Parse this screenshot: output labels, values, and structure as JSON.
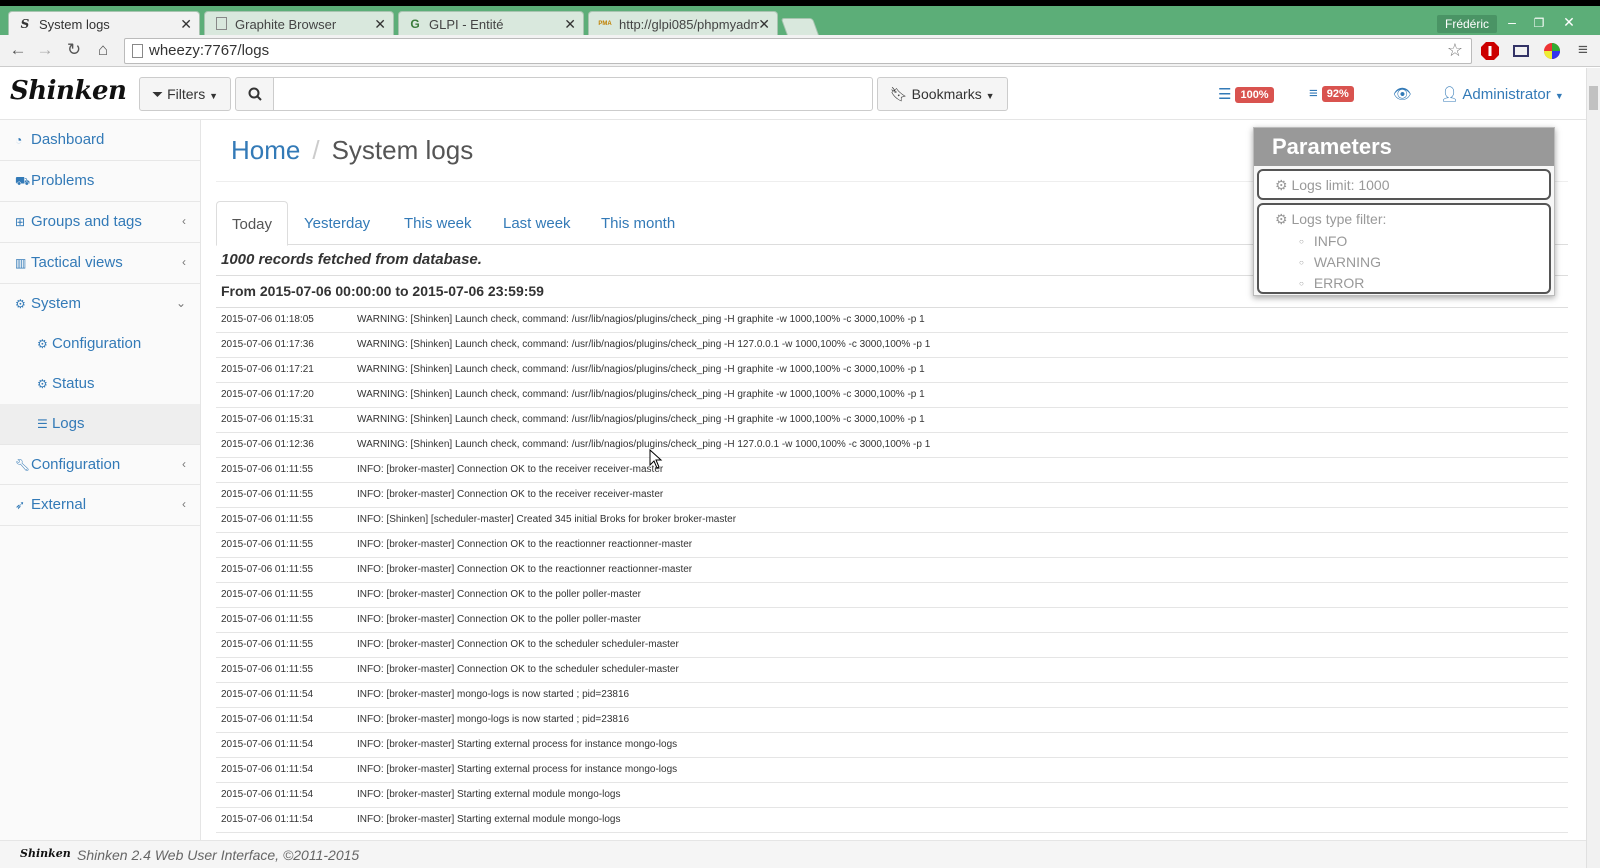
{
  "browser": {
    "tabs": [
      {
        "title": "System logs",
        "favicon": "S",
        "active": true
      },
      {
        "title": "Graphite Browser",
        "favicon": "page-icon",
        "active": false
      },
      {
        "title": "GLPI - Entité",
        "favicon": "G",
        "active": false
      },
      {
        "title": "http://glpi085/phpmyadm",
        "favicon": "PMA",
        "active": false
      }
    ],
    "window_user": "Frédéric",
    "url": "wheezy:7767/logs"
  },
  "header": {
    "logo": "Shinken",
    "filters_label": "Filters",
    "search_placeholder": "",
    "bookmarks_label": "Bookmarks",
    "indicator1_value": "100%",
    "indicator2_value": "92%",
    "user_label": "Administrator"
  },
  "sidebar": {
    "items": [
      {
        "label": "Dashboard",
        "icon": "dashboard-icon"
      },
      {
        "label": "Problems",
        "icon": "ambulance-icon"
      },
      {
        "label": "Groups and tags",
        "icon": "sitemap-icon"
      },
      {
        "label": "Tactical views",
        "icon": "bar-chart-icon"
      },
      {
        "label": "System",
        "icon": "gears-icon"
      },
      {
        "label": "Configuration",
        "icon": "gears-icon"
      },
      {
        "label": "Status",
        "icon": "gears-icon"
      },
      {
        "label": "Logs",
        "icon": "list-icon"
      },
      {
        "label": "Configuration",
        "icon": "wrench-icon"
      },
      {
        "label": "External",
        "icon": "rocket-icon"
      }
    ]
  },
  "breadcrumb": {
    "home": "Home",
    "current": "System logs"
  },
  "period_tabs": [
    "Today",
    "Yesterday",
    "This week",
    "Last week",
    "This month"
  ],
  "records_text": "1000 records fetched from database.",
  "range_text": "From 2015-07-06 00:00:00 to 2015-07-06 23:59:59",
  "logs": [
    {
      "ts": "2015-07-06 01:18:05",
      "msg": "WARNING: [Shinken] Launch check, command: /usr/lib/nagios/plugins/check_ping -H graphite -w 1000,100% -c 3000,100% -p 1"
    },
    {
      "ts": "2015-07-06 01:17:36",
      "msg": "WARNING: [Shinken] Launch check, command: /usr/lib/nagios/plugins/check_ping -H 127.0.0.1 -w 1000,100% -c 3000,100% -p 1"
    },
    {
      "ts": "2015-07-06 01:17:21",
      "msg": "WARNING: [Shinken] Launch check, command: /usr/lib/nagios/plugins/check_ping -H graphite -w 1000,100% -c 3000,100% -p 1"
    },
    {
      "ts": "2015-07-06 01:17:20",
      "msg": "WARNING: [Shinken] Launch check, command: /usr/lib/nagios/plugins/check_ping -H graphite -w 1000,100% -c 3000,100% -p 1"
    },
    {
      "ts": "2015-07-06 01:15:31",
      "msg": "WARNING: [Shinken] Launch check, command: /usr/lib/nagios/plugins/check_ping -H graphite -w 1000,100% -c 3000,100% -p 1"
    },
    {
      "ts": "2015-07-06 01:12:36",
      "msg": "WARNING: [Shinken] Launch check, command: /usr/lib/nagios/plugins/check_ping -H 127.0.0.1 -w 1000,100% -c 3000,100% -p 1"
    },
    {
      "ts": "2015-07-06 01:11:55",
      "msg": "INFO: [broker-master] Connection OK to the receiver receiver-master"
    },
    {
      "ts": "2015-07-06 01:11:55",
      "msg": "INFO: [broker-master] Connection OK to the receiver receiver-master"
    },
    {
      "ts": "2015-07-06 01:11:55",
      "msg": "INFO: [Shinken] [scheduler-master] Created 345 initial Broks for broker broker-master"
    },
    {
      "ts": "2015-07-06 01:11:55",
      "msg": "INFO: [broker-master] Connection OK to the reactionner reactionner-master"
    },
    {
      "ts": "2015-07-06 01:11:55",
      "msg": "INFO: [broker-master] Connection OK to the reactionner reactionner-master"
    },
    {
      "ts": "2015-07-06 01:11:55",
      "msg": "INFO: [broker-master] Connection OK to the poller poller-master"
    },
    {
      "ts": "2015-07-06 01:11:55",
      "msg": "INFO: [broker-master] Connection OK to the poller poller-master"
    },
    {
      "ts": "2015-07-06 01:11:55",
      "msg": "INFO: [broker-master] Connection OK to the scheduler scheduler-master"
    },
    {
      "ts": "2015-07-06 01:11:55",
      "msg": "INFO: [broker-master] Connection OK to the scheduler scheduler-master"
    },
    {
      "ts": "2015-07-06 01:11:54",
      "msg": "INFO: [broker-master] mongo-logs is now started ; pid=23816"
    },
    {
      "ts": "2015-07-06 01:11:54",
      "msg": "INFO: [broker-master] mongo-logs is now started ; pid=23816"
    },
    {
      "ts": "2015-07-06 01:11:54",
      "msg": "INFO: [broker-master] Starting external process for instance mongo-logs"
    },
    {
      "ts": "2015-07-06 01:11:54",
      "msg": "INFO: [broker-master] Starting external process for instance mongo-logs"
    },
    {
      "ts": "2015-07-06 01:11:54",
      "msg": "INFO: [broker-master] Starting external module mongo-logs"
    },
    {
      "ts": "2015-07-06 01:11:54",
      "msg": "INFO: [broker-master] Starting external module mongo-logs"
    }
  ],
  "parameters": {
    "title": "Parameters",
    "logs_limit": "Logs limit: 1000",
    "type_filter_label": "Logs type filter:",
    "types": [
      "INFO",
      "WARNING",
      "ERROR"
    ]
  },
  "footer": {
    "logo": "Shinken",
    "text": "Shinken 2.4 Web User Interface, ©2011-2015"
  },
  "colors": {
    "link": "#337ab7",
    "badge": "#d9534f",
    "tabbar": "#5cae78"
  }
}
